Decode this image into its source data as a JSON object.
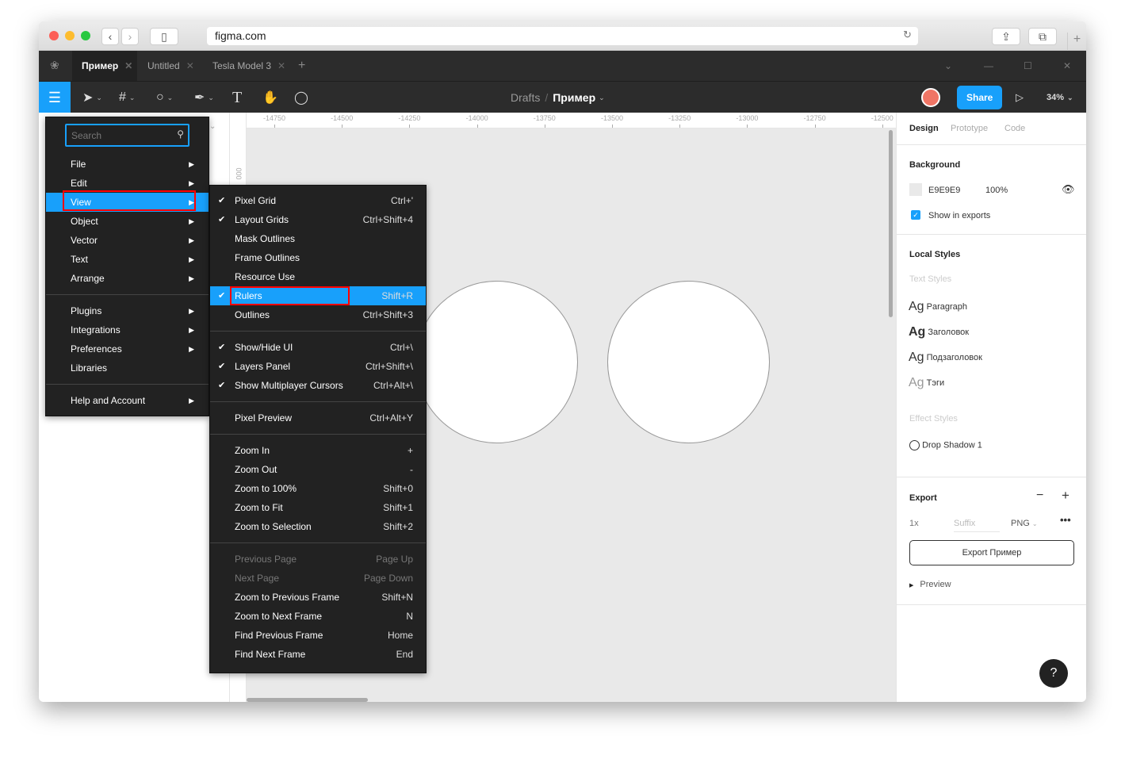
{
  "browser": {
    "url": "figma.com"
  },
  "tabs": [
    {
      "label": "Пример"
    },
    {
      "label": "Untitled"
    },
    {
      "label": "Tesla Model 3"
    }
  ],
  "toolbar": {
    "breadcrumb_root": "Drafts",
    "file_name": "Пример",
    "share": "Share",
    "zoom": "34%"
  },
  "ruler": {
    "ticks": [
      "-14750",
      "-14500",
      "-14250",
      "-14000",
      "-13750",
      "-13500",
      "-13250",
      "-13000",
      "-12750",
      "-12500"
    ],
    "vertical": "000"
  },
  "main_menu": {
    "search_placeholder": "Search",
    "groups": [
      [
        {
          "label": "File"
        },
        {
          "label": "Edit"
        },
        {
          "label": "View",
          "selected": true
        },
        {
          "label": "Object"
        },
        {
          "label": "Vector"
        },
        {
          "label": "Text"
        },
        {
          "label": "Arrange"
        }
      ],
      [
        {
          "label": "Plugins"
        },
        {
          "label": "Integrations"
        },
        {
          "label": "Preferences"
        },
        {
          "label": "Libraries",
          "noarrow": true
        }
      ],
      [
        {
          "label": "Help and Account"
        }
      ]
    ]
  },
  "view_menu": {
    "groups": [
      [
        {
          "label": "Pixel Grid",
          "shortcut": "Ctrl+'",
          "checked": true
        },
        {
          "label": "Layout Grids",
          "shortcut": "Ctrl+Shift+4",
          "checked": true
        },
        {
          "label": "Mask Outlines",
          "shortcut": ""
        },
        {
          "label": "Frame Outlines",
          "shortcut": ""
        },
        {
          "label": "Resource Use",
          "shortcut": ""
        },
        {
          "label": "Rulers",
          "shortcut": "Shift+R",
          "checked": true,
          "selected": true
        },
        {
          "label": "Outlines",
          "shortcut": "Ctrl+Shift+3"
        }
      ],
      [
        {
          "label": "Show/Hide UI",
          "shortcut": "Ctrl+\\",
          "checked": true
        },
        {
          "label": "Layers Panel",
          "shortcut": "Ctrl+Shift+\\",
          "checked": true
        },
        {
          "label": "Show Multiplayer Cursors",
          "shortcut": "Ctrl+Alt+\\",
          "checked": true
        }
      ],
      [
        {
          "label": "Pixel Preview",
          "shortcut": "Ctrl+Alt+Y"
        }
      ],
      [
        {
          "label": "Zoom In",
          "shortcut": "+"
        },
        {
          "label": "Zoom Out",
          "shortcut": "-"
        },
        {
          "label": "Zoom to 100%",
          "shortcut": "Shift+0"
        },
        {
          "label": "Zoom to Fit",
          "shortcut": "Shift+1"
        },
        {
          "label": "Zoom to Selection",
          "shortcut": "Shift+2"
        }
      ],
      [
        {
          "label": "Previous Page",
          "shortcut": "Page Up",
          "disabled": true
        },
        {
          "label": "Next Page",
          "shortcut": "Page Down",
          "disabled": true
        },
        {
          "label": "Zoom to Previous Frame",
          "shortcut": "Shift+N"
        },
        {
          "label": "Zoom to Next Frame",
          "shortcut": "N"
        },
        {
          "label": "Find Previous Frame",
          "shortcut": "Home"
        },
        {
          "label": "Find Next Frame",
          "shortcut": "End"
        }
      ]
    ]
  },
  "panel": {
    "tabs": [
      "Design",
      "Prototype",
      "Code"
    ],
    "background": {
      "title": "Background",
      "hex": "E9E9E9",
      "opacity": "100%",
      "show_exports": "Show in exports",
      "color": "#e9e9e9"
    },
    "local_styles": {
      "title": "Local Styles",
      "text_styles": "Text Styles",
      "styles": [
        {
          "sample": "Ag",
          "name": "Paragraph"
        },
        {
          "sample": "Ag",
          "name": "Заголовок"
        },
        {
          "sample": "Ag",
          "name": "Подзаголовок"
        },
        {
          "sample": "Ag",
          "name": "Тэги"
        }
      ],
      "effect_styles": "Effect Styles",
      "effect": "Drop Shadow 1"
    },
    "export": {
      "title": "Export",
      "scale": "1x",
      "suffix_placeholder": "Suffix",
      "format": "PNG",
      "button": "Export Пример",
      "preview": "Preview"
    }
  },
  "help": "?",
  "colors": {
    "accent": "#18a0fb",
    "dark": "#2c2c2c",
    "highlight": "#ff0000"
  }
}
